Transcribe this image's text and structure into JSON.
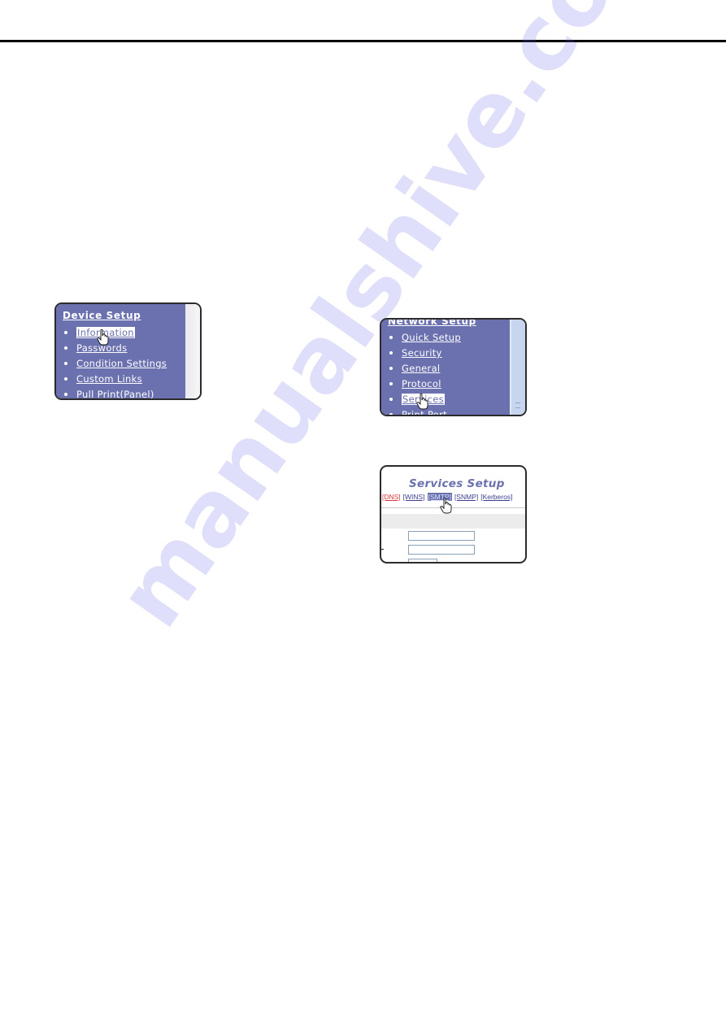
{
  "watermark": "manualshive.com",
  "device_setup": {
    "title": "Device Setup",
    "items": [
      {
        "label": "Information",
        "selected": true
      },
      {
        "label": "Passwords",
        "selected": false
      },
      {
        "label": "Condition Settings",
        "selected": false
      },
      {
        "label": "Custom Links",
        "selected": false
      },
      {
        "label": "Pull Print(Panel)",
        "selected": false
      }
    ],
    "cursor_icon": "hand-pointer-icon"
  },
  "network_setup": {
    "title": "Network Setup",
    "items": [
      {
        "label": "Quick Setup",
        "selected": false
      },
      {
        "label": "Security",
        "selected": false
      },
      {
        "label": "General",
        "selected": false
      },
      {
        "label": "Protocol",
        "selected": false
      },
      {
        "label": "Services",
        "selected": true
      },
      {
        "label": "Print Port",
        "selected": false
      }
    ],
    "cursor_icon": "hand-pointer-icon"
  },
  "services_setup": {
    "title": "Services Setup",
    "tabs": [
      {
        "label": "[DNS]",
        "color": "#d9363e"
      },
      {
        "label": "[WINS]"
      },
      {
        "label": "[SMTP]",
        "active": true
      },
      {
        "label": "[SNMP]"
      },
      {
        "label": "[Kerberos]"
      }
    ],
    "inputs": [
      {
        "value": ""
      },
      {
        "value": ""
      },
      {
        "value": ""
      }
    ],
    "cursor_icon": "hand-pointer-icon"
  },
  "colors": {
    "menu_background": "#6a71ae",
    "accent": "#6a71ae"
  }
}
